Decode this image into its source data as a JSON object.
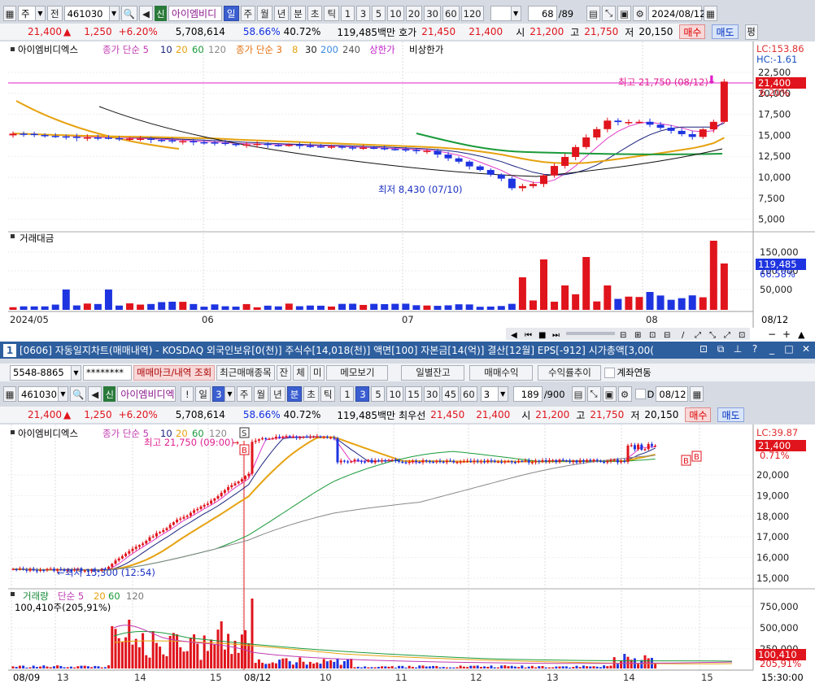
{
  "top": {
    "toolbar": {
      "type_select": "주",
      "prev_btn": "전",
      "code": "461030",
      "shin": "신",
      "name": "아이엠비디",
      "periods": [
        "일",
        "주",
        "월",
        "년",
        "분",
        "초",
        "틱"
      ],
      "active_period": "일",
      "nums": [
        "1",
        "3",
        "5",
        "10",
        "20",
        "30",
        "60",
        "120"
      ],
      "count": "68",
      "count_total": "/89",
      "date": "2024/08/12"
    },
    "quote": {
      "price": "21,400",
      "arrow": "▲",
      "change": "1,250",
      "pct": "+6.20%",
      "volume": "5,708,614",
      "ratio1": "58.66%",
      "ratio2": "40.72%",
      "amount": "119,485백만",
      "ask_label": "호가",
      "ask": "21,450",
      "bid": "21,400",
      "open_label": "시",
      "open": "21,200",
      "high_label": "고",
      "high": "21,750",
      "low_label": "저",
      "low": "20,150",
      "buy": "매수",
      "sell": "매도",
      "avg": "평"
    },
    "legend": {
      "name": "아이엠비디엑스",
      "ma1_label": "종가 단순 5",
      "ma1_nums": [
        "10",
        "20",
        "60",
        "120"
      ],
      "ma2_label": "종가 단순 3",
      "ma2_nums": [
        "8",
        "30",
        "200",
        "240"
      ],
      "upper": "상한가",
      "vi": "비상한가"
    },
    "price_axis": [
      "22,500",
      "20,000",
      "17,500",
      "15,000",
      "12,500",
      "10,000",
      "7,500",
      "5,000"
    ],
    "lc": "LC:153.86",
    "hc": "HC:-1.61",
    "cur_tag": "21,400",
    "cur_pct": "6.20%",
    "high_note": "최고 21,750 (08/12)",
    "low_note": "최저 8,430 (07/10)",
    "vol_label": "거래대금",
    "vol_axis": [
      "150,000",
      "100,000",
      "50,000"
    ],
    "vol_tag": "119,485",
    "vol_pct": "66.58%",
    "x_labels": [
      "2024/05",
      "06",
      "07",
      "08"
    ],
    "x_right": "08/12",
    "colors": {
      "up": "#e0141c",
      "down": "#1e34e0",
      "ma5": "#e03cc8",
      "ma10": "#1a237e",
      "ma20": "#e6a210",
      "ma60": "#1a9a3a",
      "ma120": "#111111"
    }
  },
  "window": {
    "num": "1",
    "title": "[0606] 자동일지차트(매매내역) - KOSDAQ 외국인보유[0(천)] 주식수[14,018(천)] 액면[100] 자본금[14(억)] 결산[12월] EPS[-912] 시가총액[3,00("
  },
  "bottom": {
    "acct": {
      "account": "5548-8865",
      "password": "********",
      "btn_mark": "매매마크/내역 조회",
      "btn_recent": "최근매매종목",
      "btn_jan": "잔",
      "btn_che": "체",
      "btn_mi": "미",
      "btn_memo": "메모보기",
      "btn_daily": "일별잔고",
      "btn_profit": "매매수익",
      "btn_rate": "수익률추이",
      "check_label": "계좌연동"
    },
    "toolbar": {
      "code": "461030",
      "shin": "신",
      "name": "아이엠비디엑",
      "excl": "!",
      "day": "일",
      "day_num": "3",
      "periods": [
        "주",
        "월",
        "년",
        "분",
        "초",
        "틱"
      ],
      "active_period": "분",
      "nums": [
        "1",
        "3",
        "5",
        "10",
        "15",
        "30",
        "45",
        "60"
      ],
      "active_num": "3",
      "sel_num": "3",
      "count": "189",
      "count_total": "/900",
      "d_label": "D",
      "date": "08/12"
    },
    "quote": {
      "price": "21,400",
      "arrow": "▲",
      "change": "1,250",
      "pct": "+6.20%",
      "volume": "5,708,614",
      "ratio1": "58.66%",
      "ratio2": "40.72%",
      "amount": "119,485백만",
      "ask_label": "최우선",
      "ask": "21,450",
      "bid": "21,400",
      "open_label": "시",
      "open": "21,200",
      "high_label": "고",
      "high": "21,750",
      "low_label": "저",
      "low": "20,150",
      "buy": "매수",
      "sell": "매도"
    },
    "legend": {
      "name": "아이엠비디엑스",
      "ma_label": "종가 단순 5",
      "ma_nums": [
        "10",
        "20",
        "60",
        "120"
      ]
    },
    "price_axis": [
      "20,000",
      "19,000",
      "18,000",
      "17,000",
      "16,000",
      "15,000"
    ],
    "lc": "LC:39.87",
    "cur_tag": "21,400",
    "cur_pct": "0.71%",
    "high_note": "최고 21,750 (09:00)",
    "low_note": "최저 15,300 (12:54)",
    "s_mark": "S",
    "b_mark": "B",
    "vol_label": "거래량",
    "vol_ma_label": "단순 5",
    "vol_ma_nums": [
      "20",
      "60",
      "120"
    ],
    "vol_info": "100,410주(205,91%)",
    "vol_axis": [
      "750,000",
      "500,000",
      "250,000"
    ],
    "vol_tag": "100,410",
    "vol_pct": "205,91%",
    "x_labels": [
      "08/09",
      "13",
      "14",
      "15",
      "08/12",
      "10",
      "11",
      "12",
      "13",
      "14",
      "15"
    ],
    "x_right": "15:30:00"
  }
}
